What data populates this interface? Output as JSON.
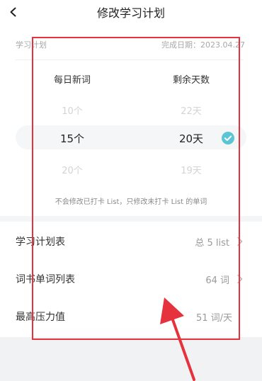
{
  "header": {
    "title": "修改学习计划",
    "back_icon": "chevron-left-icon"
  },
  "plan": {
    "label": "学习计划",
    "completion_date": "完成日期：2023.04.27"
  },
  "picker": {
    "columns": [
      {
        "header": "每日新词",
        "above": "10个",
        "selected": "15个",
        "below": "20个"
      },
      {
        "header": "剩余天数",
        "above": "22天",
        "selected": "20天",
        "below": "19天"
      }
    ],
    "check_icon": "check-circle-icon",
    "accent_color": "#5bc5d3"
  },
  "note": "不会修改已打卡 List，只修改未打卡 List 的单词",
  "rows": [
    {
      "label": "学习计划表",
      "value": "总 5 list",
      "chevron": true
    },
    {
      "label": "词书单词列表",
      "value": "64 词",
      "chevron": true
    },
    {
      "label": "最高压力值",
      "value": "51 词/天",
      "chevron": false
    }
  ],
  "annotation_color": "#e6323c"
}
